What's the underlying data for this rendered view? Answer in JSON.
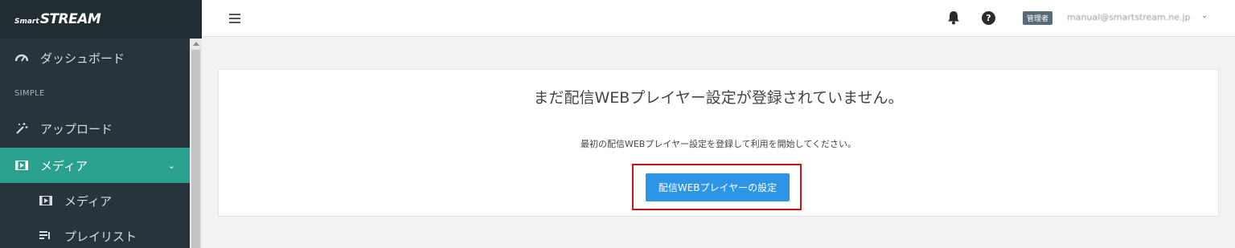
{
  "brand": {
    "prefix": "Smart",
    "name": "STREAM"
  },
  "sidebar": {
    "dashboard": "ダッシュボード",
    "section_simple": "SIMPLE",
    "upload": "アップロード",
    "media": "メディア",
    "sub_media": "メディア",
    "playlist": "プレイリスト"
  },
  "topbar": {
    "role_badge": "管理者",
    "user_email": "manual@smartstream.ne.jp"
  },
  "main": {
    "empty_title": "まだ配信WEBプレイヤー設定が登録されていません。",
    "empty_desc": "最初の配信WEBプレイヤー設定を登録して利用を開始してください。",
    "cta_label": "配信WEBプレイヤーの設定"
  },
  "colors": {
    "sidebar_bg": "#27343b",
    "active_item": "#2aa08f",
    "primary_button": "#2c95e7",
    "highlight_border": "#d0121b"
  }
}
